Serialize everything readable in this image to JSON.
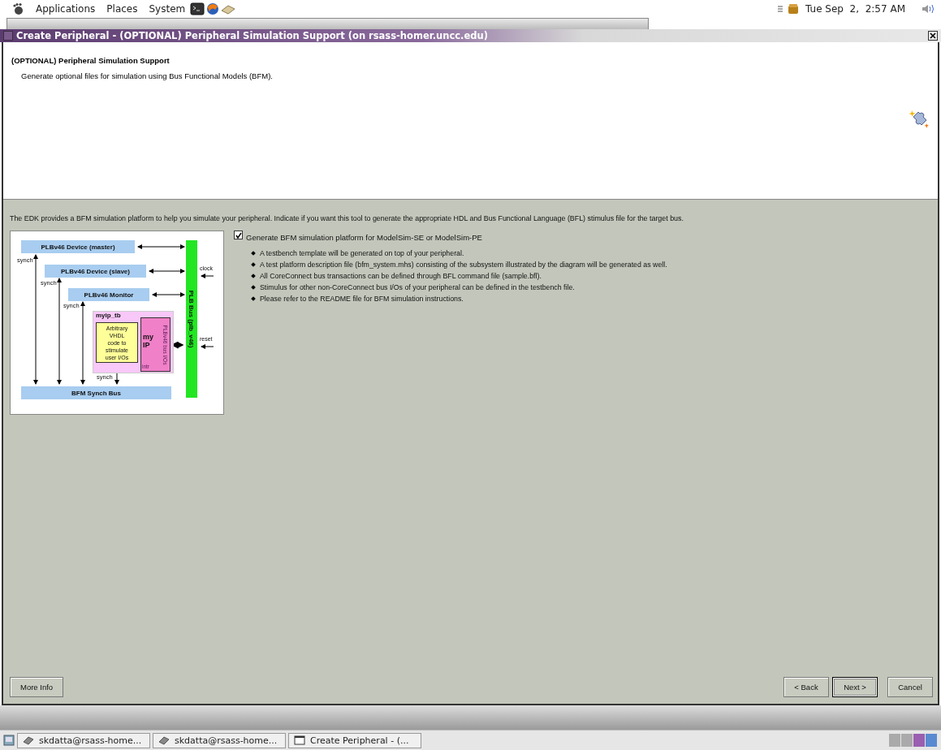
{
  "top_panel": {
    "menus": [
      "Applications",
      "Places",
      "System"
    ],
    "clock": "Tue Sep  2,  2:57 AM"
  },
  "window": {
    "title": "Create Peripheral - (OPTIONAL) Peripheral Simulation Support (on rsass-homer.uncc.edu)",
    "header": {
      "title": "(OPTIONAL) Peripheral Simulation Support",
      "description": "Generate optional files for simulation using Bus Functional Models (BFM)."
    },
    "intro": "The EDK provides a BFM simulation platform to help you simulate your peripheral. Indicate if you want this tool to generate the appropriate HDL and Bus Functional Language (BFL) stimulus file for the target bus.",
    "diagram": {
      "devices": [
        "PLBv46 Device (master)",
        "PLBv46 Device (slave)",
        "PLBv46 Monitor"
      ],
      "bus": "PLB Bus (plb_v46)",
      "synch_bus": "BFM Synch Bus",
      "testbench": "myip_tb",
      "stimulus": [
        "Arbitrary",
        "VHDL",
        "code to",
        "stimulate",
        "user I/Os"
      ],
      "core": [
        "my",
        "IP"
      ],
      "core_port": "PLBv46 bus I/Os",
      "interrupt": "intr",
      "synch_labels": [
        "synch",
        "synch",
        "synch",
        "synch"
      ],
      "clock": "clock",
      "reset": "reset"
    },
    "option": {
      "label": "Generate BFM simulation platform for ModelSim-SE or ModelSim-PE",
      "checked": true
    },
    "bullets": [
      "A testbench template will be generated on top of your peripheral.",
      "A test platform description file (bfm_system.mhs) consisting of the subsystem illustrated by the diagram will be generated as well.",
      "All CoreConnect bus transactions can be defined through BFL command file (sample.bfl).",
      "Stimulus for other non-CoreConnect bus I/Os of your peripheral can be defined in the testbench file.",
      "Please refer to the README file for BFM simulation instructions."
    ],
    "buttons": [
      {
        "label": "More Info",
        "selected": false
      },
      {
        "label": "< Back",
        "selected": false
      },
      {
        "label": "Next >",
        "selected": true
      },
      {
        "label": "Cancel",
        "selected": false
      }
    ]
  },
  "taskbar": [
    {
      "kind": "terminal",
      "label": "skdatta@rsass-home...",
      "selected": false
    },
    {
      "kind": "terminal",
      "label": "skdatta@rsass-home...",
      "selected": false
    },
    {
      "kind": "window",
      "label": "Create Peripheral - (...",
      "selected": false
    }
  ]
}
